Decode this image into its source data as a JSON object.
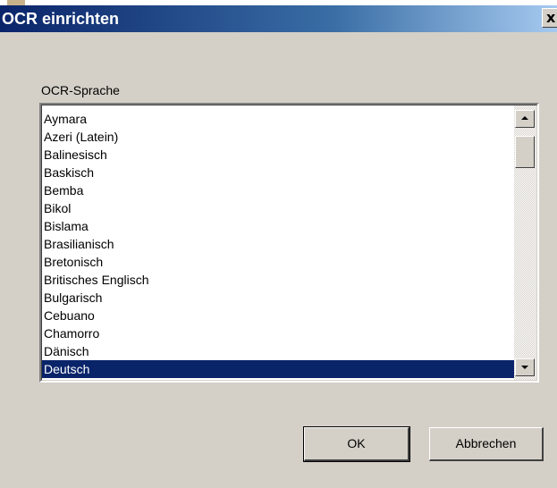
{
  "dialog": {
    "title": "OCR einrichten",
    "close_glyph": "x"
  },
  "ocr": {
    "label": "OCR-Sprache",
    "languages": [
      "Aymara",
      "Azeri (Latein)",
      "Balinesisch",
      "Baskisch",
      "Bemba",
      "Bikol",
      "Bislama",
      "Brasilianisch",
      "Bretonisch",
      "Britisches Englisch",
      "Bulgarisch",
      "Cebuano",
      "Chamorro",
      "Dänisch",
      "Deutsch"
    ],
    "selected": "Deutsch"
  },
  "buttons": {
    "ok": "OK",
    "cancel": "Abbrechen"
  },
  "icons": {
    "close": "close-icon",
    "scroll_up": "scroll-up-arrow-icon",
    "scroll_down": "scroll-down-arrow-icon"
  },
  "colors": {
    "titlebar_start": "#0a246a",
    "titlebar_end": "#a6caf0",
    "selection": "#0a246a",
    "dialog_bg": "#d4d0c8"
  }
}
